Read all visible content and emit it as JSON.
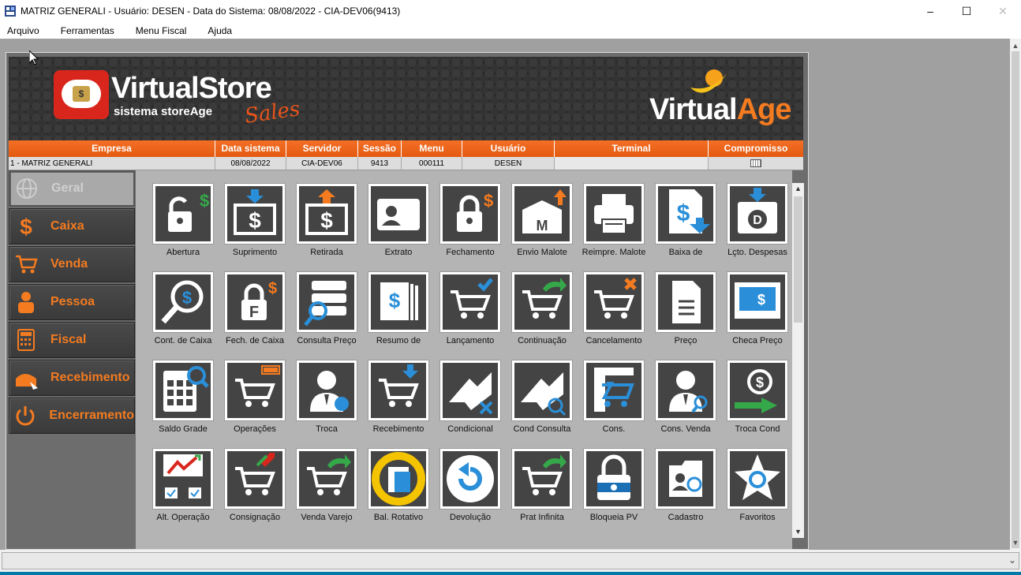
{
  "window": {
    "title": "MATRIZ GENERALI - Usuário: DESEN - Data do Sistema: 08/08/2022 - CIA-DEV06(9413)",
    "controls": [
      "minimize",
      "maximize",
      "close"
    ]
  },
  "menu": {
    "arquivo": "Arquivo",
    "ferramentas": "Ferramentas",
    "menu_fiscal": "Menu Fiscal",
    "ajuda": "Ajuda"
  },
  "brand": {
    "virtual": "Virtual",
    "store": "Store",
    "subtitle": "sistema storeAge",
    "sales": "Sales",
    "va_virtual": "Virtual",
    "va_age": "Age"
  },
  "info": {
    "headers": {
      "empresa": "Empresa",
      "data_sistema": "Data sistema",
      "servidor": "Servidor",
      "sessao": "Sessão",
      "menu": "Menu",
      "usuario": "Usuário",
      "terminal": "Terminal",
      "compromisso": "Compromisso"
    },
    "values": {
      "empresa": "1 - MATRIZ GENERALI",
      "data_sistema": "08/08/2022",
      "servidor": "CIA-DEV06",
      "sessao": "9413",
      "menu": "000111",
      "usuario": "DESEN",
      "terminal": ""
    }
  },
  "sidebar": {
    "items": [
      {
        "label": "Geral",
        "icon": "globe-icon",
        "active": true
      },
      {
        "label": "Caixa",
        "icon": "dollar-icon"
      },
      {
        "label": "Venda",
        "icon": "cart-icon"
      },
      {
        "label": "Pessoa",
        "icon": "person-icon"
      },
      {
        "label": "Fiscal",
        "icon": "calculator-icon"
      },
      {
        "label": "Recebimento",
        "icon": "hand-icon"
      },
      {
        "label": "Encerramento",
        "icon": "power-icon"
      }
    ]
  },
  "tiles": {
    "t0": "Abertura",
    "t1": "Suprimento",
    "t2": "Retirada",
    "t3": "Extrato",
    "t4": "Fechamento",
    "t5": "Envio Malote",
    "t6": "Reimpre. Malote",
    "t7": "Baixa de",
    "t8": "Lçto. Despesas",
    "t9": "Cont. de Caixa",
    "t10": "Fech. de Caixa",
    "t11": "Consulta Preço",
    "t12": "Resumo de",
    "t13": "Lançamento",
    "t14": "Continuação",
    "t15": "Cancelamento",
    "t16": "Preço",
    "t17": "Checa Preço",
    "t18": "Saldo Grade",
    "t19": "Operações",
    "t20": "Troca",
    "t21": "Recebimento",
    "t22": "Condicional",
    "t23": "Cond Consulta",
    "t24": "Cons.",
    "t25": "Cons. Venda",
    "t26": "Troca Cond",
    "t27": "Alt. Operação",
    "t28": "Consignação",
    "t29": "Venda Varejo",
    "t30": "Bal. Rotativo",
    "t31": "Devolução",
    "t32": "Prat Infinita",
    "t33": "Bloqueia PV",
    "t34": "Cadastro",
    "t35": "Favoritos"
  },
  "colors": {
    "accent": "#f47b20",
    "header": "#e35a10",
    "tile_bg": "#444444"
  }
}
